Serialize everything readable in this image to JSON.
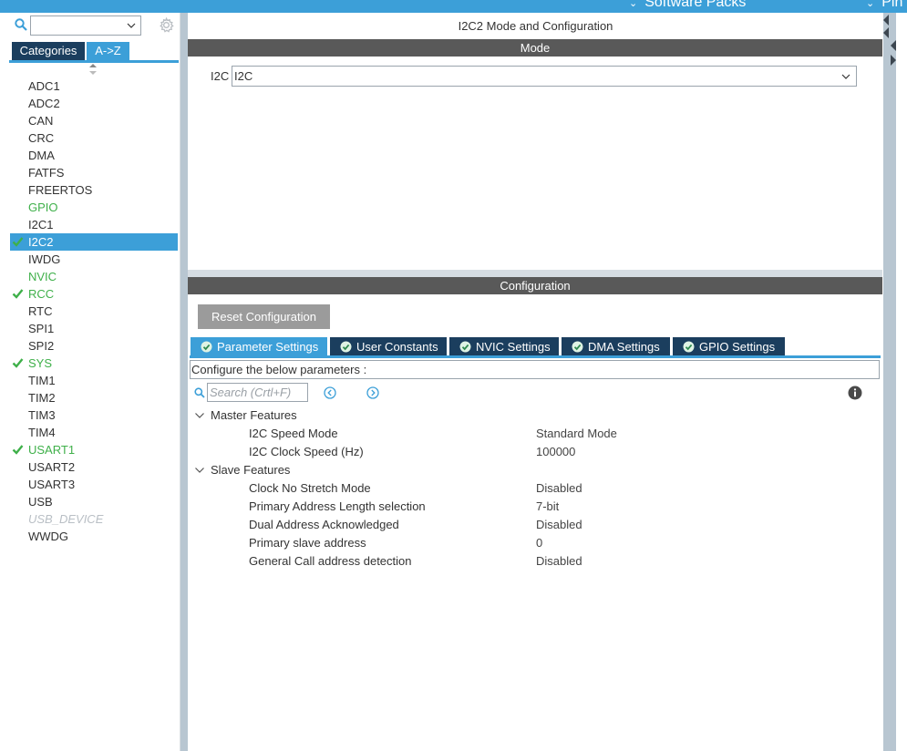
{
  "topbar": {
    "software_packs": "Software Packs",
    "pinout": "Pin"
  },
  "sidebar": {
    "search_value": "",
    "tabs": [
      "Categories",
      "A->Z"
    ],
    "items": [
      {
        "label": "ADC1",
        "state": "normal"
      },
      {
        "label": "ADC2",
        "state": "normal"
      },
      {
        "label": "CAN",
        "state": "normal"
      },
      {
        "label": "CRC",
        "state": "normal"
      },
      {
        "label": "DMA",
        "state": "normal"
      },
      {
        "label": "FATFS",
        "state": "normal"
      },
      {
        "label": "FREERTOS",
        "state": "normal"
      },
      {
        "label": "GPIO",
        "state": "green"
      },
      {
        "label": "I2C1",
        "state": "normal"
      },
      {
        "label": "I2C2",
        "state": "selected-checked"
      },
      {
        "label": "IWDG",
        "state": "normal"
      },
      {
        "label": "NVIC",
        "state": "green"
      },
      {
        "label": "RCC",
        "state": "green-checked"
      },
      {
        "label": "RTC",
        "state": "normal"
      },
      {
        "label": "SPI1",
        "state": "normal"
      },
      {
        "label": "SPI2",
        "state": "normal"
      },
      {
        "label": "SYS",
        "state": "green-checked"
      },
      {
        "label": "TIM1",
        "state": "normal"
      },
      {
        "label": "TIM2",
        "state": "normal"
      },
      {
        "label": "TIM3",
        "state": "normal"
      },
      {
        "label": "TIM4",
        "state": "normal"
      },
      {
        "label": "USART1",
        "state": "green-checked"
      },
      {
        "label": "USART2",
        "state": "normal"
      },
      {
        "label": "USART3",
        "state": "normal"
      },
      {
        "label": "USB",
        "state": "normal"
      },
      {
        "label": "USB_DEVICE",
        "state": "disabled"
      },
      {
        "label": "WWDG",
        "state": "normal"
      }
    ]
  },
  "main": {
    "title": "I2C2 Mode and Configuration",
    "mode_header": "Mode",
    "mode_label": "I2C",
    "mode_value": "I2C",
    "config_header": "Configuration",
    "reset_button": "Reset Configuration",
    "tabs": [
      {
        "label": "Parameter Settings",
        "active": true
      },
      {
        "label": "User Constants",
        "active": false
      },
      {
        "label": "NVIC Settings",
        "active": false
      },
      {
        "label": "DMA Settings",
        "active": false
      },
      {
        "label": "GPIO Settings",
        "active": false
      }
    ],
    "configure_text": "Configure the below parameters :",
    "search_placeholder": "Search (Crtl+F)",
    "groups": [
      {
        "label": "Master Features",
        "params": [
          {
            "name": "I2C Speed Mode",
            "value": "Standard Mode"
          },
          {
            "name": "I2C Clock Speed (Hz)",
            "value": "100000"
          }
        ]
      },
      {
        "label": "Slave Features",
        "params": [
          {
            "name": "Clock No Stretch Mode",
            "value": "Disabled"
          },
          {
            "name": "Primary Address Length selection",
            "value": "7-bit"
          },
          {
            "name": "Dual Address Acknowledged",
            "value": "Disabled"
          },
          {
            "name": "Primary slave address",
            "value": "0"
          },
          {
            "name": "General Call address detection",
            "value": "Disabled"
          }
        ]
      }
    ]
  },
  "colors": {
    "accent": "#3c9fd8",
    "navy": "#1b3e5e",
    "green": "#3fb04a",
    "header": "#595959"
  }
}
